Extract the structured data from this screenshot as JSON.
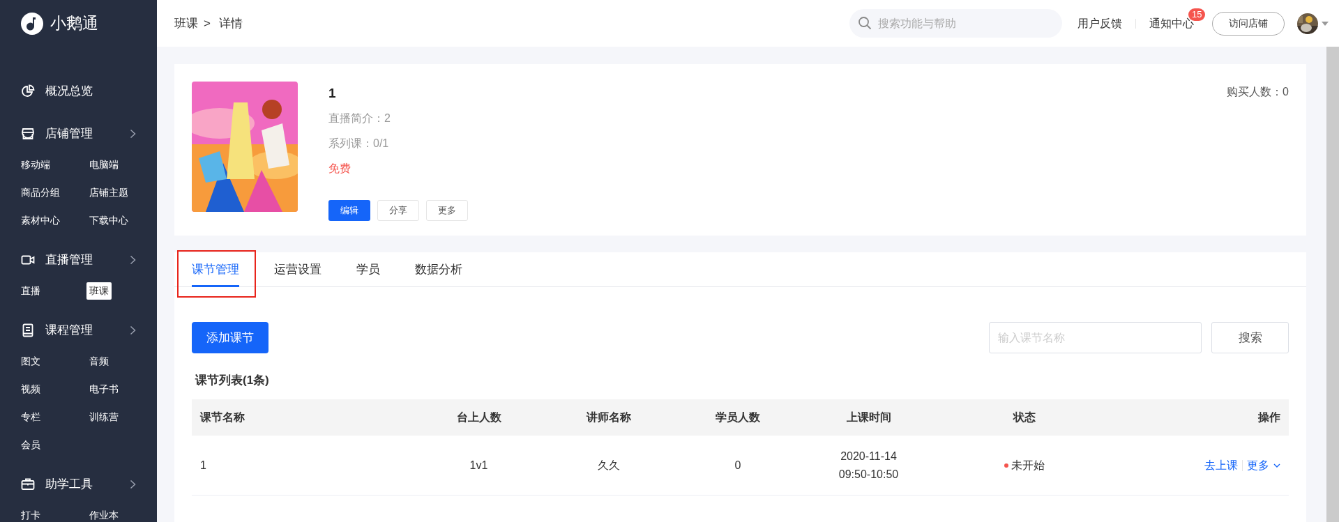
{
  "sidebar": {
    "logo": "小鹅通",
    "groups": [
      {
        "kind": "pie",
        "label": "概况总览",
        "expandable": false
      },
      {
        "kind": "store",
        "label": "店铺管理",
        "expandable": true,
        "items": [
          {
            "label": "移动端",
            "selected": false
          },
          {
            "label": "电脑端",
            "selected": false
          },
          {
            "label": "商品分组",
            "selected": false
          },
          {
            "label": "店铺主题",
            "selected": false
          },
          {
            "label": "素材中心",
            "selected": false
          },
          {
            "label": "下载中心",
            "selected": false
          }
        ]
      },
      {
        "kind": "camera",
        "label": "直播管理",
        "expandable": true,
        "items": [
          {
            "label": "直播",
            "selected": false
          },
          {
            "label": "班课",
            "selected": true
          }
        ]
      },
      {
        "kind": "book",
        "label": "课程管理",
        "expandable": true,
        "items": [
          {
            "label": "图文",
            "selected": false
          },
          {
            "label": "音频",
            "selected": false
          },
          {
            "label": "视频",
            "selected": false
          },
          {
            "label": "电子书",
            "selected": false
          },
          {
            "label": "专栏",
            "selected": false
          },
          {
            "label": "训练营",
            "selected": false
          },
          {
            "label": "会员",
            "selected": false
          }
        ]
      },
      {
        "kind": "briefcase",
        "label": "助学工具",
        "expandable": true,
        "items": [
          {
            "label": "打卡",
            "selected": false
          },
          {
            "label": "作业本",
            "selected": false
          }
        ]
      }
    ]
  },
  "topbar": {
    "breadcrumb": {
      "parent": "班课",
      "separator": ">",
      "current": "详情"
    },
    "search": {
      "placeholder": "搜索功能与帮助"
    },
    "feedback": "用户反馈",
    "notifications": {
      "label": "通知中心",
      "badge": "15"
    },
    "visit_button": "访问店铺"
  },
  "course": {
    "title": "1",
    "intro": "直播简介：2",
    "series": "系列课：0/1",
    "price": "免费",
    "buyers": "购买人数：0",
    "buttons": [
      {
        "label": "编辑",
        "primary": true
      },
      {
        "label": "分享",
        "primary": false
      },
      {
        "label": "更多",
        "primary": false
      }
    ]
  },
  "tabs": [
    {
      "label": "课节管理",
      "selected": true,
      "highlighted": true
    },
    {
      "label": "运营设置",
      "selected": false,
      "highlighted": false
    },
    {
      "label": "学员",
      "selected": false,
      "highlighted": false
    },
    {
      "label": "数据分析",
      "selected": false,
      "highlighted": false
    }
  ],
  "lessons": {
    "add_button": "添加课节",
    "search": {
      "placeholder": "输入课节名称"
    },
    "search_button": "搜索",
    "title": "课节列表(1条)",
    "table": {
      "columns": [
        "课节名称",
        "台上人数",
        "讲师名称",
        "学员人数",
        "上课时间",
        "状态",
        "操作"
      ],
      "rows": [
        {
          "name": "1",
          "stage_count": "1v1",
          "teacher": "久久",
          "students": "0",
          "date": "2020-11-14",
          "time": "09:50-10:50",
          "status": {
            "label": "未开始",
            "color": "#f5544d"
          },
          "actions": [
            {
              "label": "去上课",
              "dropdown": false
            },
            {
              "label": "更多",
              "dropdown": true
            }
          ]
        }
      ]
    }
  }
}
